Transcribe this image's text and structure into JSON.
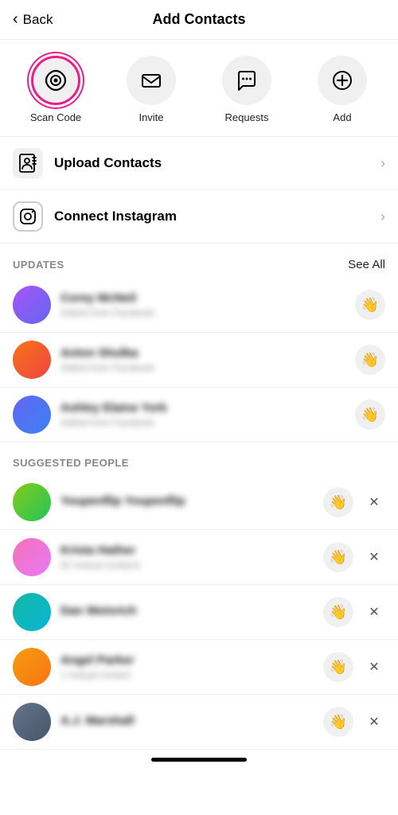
{
  "header": {
    "back_label": "Back",
    "title": "Add Contacts"
  },
  "quick_actions": [
    {
      "id": "scan-code",
      "label": "Scan Code",
      "icon": "⊚",
      "highlighted": true
    },
    {
      "id": "invite",
      "label": "Invite",
      "icon": "✉",
      "highlighted": false
    },
    {
      "id": "requests",
      "label": "Requests",
      "icon": "💬",
      "highlighted": false
    },
    {
      "id": "add",
      "label": "Add",
      "icon": "⊕",
      "highlighted": false
    }
  ],
  "menu_items": [
    {
      "id": "upload-contacts",
      "label": "Upload Contacts",
      "icon": "📋"
    },
    {
      "id": "connect-instagram",
      "label": "Connect Instagram",
      "icon": "⬜"
    }
  ],
  "updates_section": {
    "title": "UPDATES",
    "see_all_label": "See All",
    "people": [
      {
        "id": "u1",
        "name": "Corey McNeil",
        "sub": "Added from Facebook",
        "av": "av1"
      },
      {
        "id": "u2",
        "name": "Anton Shulba",
        "sub": "Added from Facebook",
        "av": "av2"
      },
      {
        "id": "u3",
        "name": "Ashley Elaine York",
        "sub": "Added from Facebook",
        "av": "av3"
      }
    ]
  },
  "suggested_section": {
    "title": "SUGGESTED PEOPLE",
    "people": [
      {
        "id": "s1",
        "name": "Youpenflip Youpenflip",
        "sub": "",
        "av": "av4"
      },
      {
        "id": "s2",
        "name": "Krista Hather",
        "sub": "81 mutual contacts",
        "av": "av5"
      },
      {
        "id": "s3",
        "name": "Dan Weinrich",
        "sub": "",
        "av": "av6"
      },
      {
        "id": "s4",
        "name": "Angel Parker",
        "sub": "1 mutual contact",
        "av": "av7"
      },
      {
        "id": "s5",
        "name": "A.J. Marshall",
        "sub": "",
        "av": "av8"
      }
    ]
  },
  "icons": {
    "wave": "👋",
    "dismiss": "✕",
    "chevron_right": "›",
    "chevron_left": "‹"
  }
}
